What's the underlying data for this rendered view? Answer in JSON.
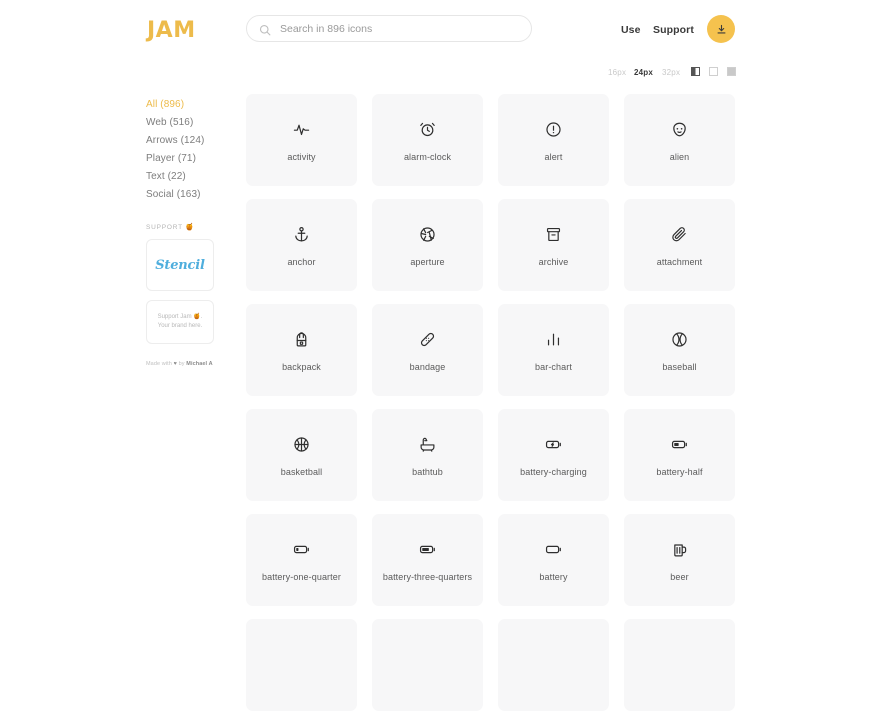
{
  "header": {
    "logo": "JAM",
    "search": {
      "placeholder": "Search in 896 icons",
      "value": "",
      "icon": "search-icon"
    },
    "nav": {
      "use": "Use",
      "support": "Support"
    },
    "download_button": {
      "icon": "download-icon",
      "color": "#F5C24E"
    }
  },
  "toolbar": {
    "sizes": [
      {
        "label": "16px",
        "active": false
      },
      {
        "label": "24px",
        "active": true
      },
      {
        "label": "32px",
        "active": false
      }
    ],
    "backgrounds": [
      {
        "name": "split-swatch",
        "active": true
      },
      {
        "name": "light-swatch",
        "active": false
      },
      {
        "name": "gray-swatch",
        "active": false
      }
    ]
  },
  "sidebar": {
    "categories": [
      {
        "label": "All (896)",
        "active": true
      },
      {
        "label": "Web (516)",
        "active": false
      },
      {
        "label": "Arrows (124)",
        "active": false
      },
      {
        "label": "Player (71)",
        "active": false
      },
      {
        "label": "Text (22)",
        "active": false
      },
      {
        "label": "Social (163)",
        "active": false
      }
    ],
    "support_heading": "SUPPORT",
    "support_heading_emoji": "🍯",
    "sponsor": {
      "name": "Stencil",
      "color": "#4FAEDD"
    },
    "sponsor_slot": {
      "line1": "Support Jam 🍯.",
      "line2": "Your brand here."
    },
    "credit": {
      "prefix": "Made with",
      "heart": "♥",
      "middle": "by",
      "author": "Michael A"
    }
  },
  "grid": {
    "icons": [
      {
        "name": "activity",
        "glyph": "activity"
      },
      {
        "name": "alarm-clock",
        "glyph": "alarm-clock"
      },
      {
        "name": "alert",
        "glyph": "alert"
      },
      {
        "name": "alien",
        "glyph": "alien"
      },
      {
        "name": "anchor",
        "glyph": "anchor"
      },
      {
        "name": "aperture",
        "glyph": "aperture"
      },
      {
        "name": "archive",
        "glyph": "archive"
      },
      {
        "name": "attachment",
        "glyph": "attachment"
      },
      {
        "name": "backpack",
        "glyph": "backpack"
      },
      {
        "name": "bandage",
        "glyph": "bandage"
      },
      {
        "name": "bar-chart",
        "glyph": "bar-chart"
      },
      {
        "name": "baseball",
        "glyph": "baseball"
      },
      {
        "name": "basketball",
        "glyph": "basketball"
      },
      {
        "name": "bathtub",
        "glyph": "bathtub"
      },
      {
        "name": "battery-charging",
        "glyph": "battery-charging"
      },
      {
        "name": "battery-half",
        "glyph": "battery-half"
      },
      {
        "name": "battery-one-quarter",
        "glyph": "battery-one-quarter"
      },
      {
        "name": "battery-three-quarters",
        "glyph": "battery-three-quarters"
      },
      {
        "name": "battery",
        "glyph": "battery"
      },
      {
        "name": "beer",
        "glyph": "beer"
      },
      {
        "name": "",
        "glyph": ""
      },
      {
        "name": "",
        "glyph": ""
      },
      {
        "name": "",
        "glyph": ""
      },
      {
        "name": "",
        "glyph": ""
      }
    ]
  }
}
